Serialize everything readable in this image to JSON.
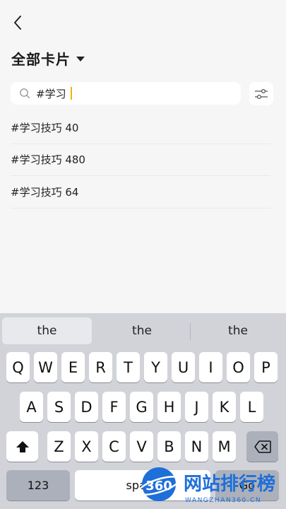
{
  "header": {
    "title": "全部卡片"
  },
  "search": {
    "query": "#学习"
  },
  "results": [
    "#学习技巧 40",
    "#学习技巧 480",
    "#学习技巧 64"
  ],
  "keyboard": {
    "suggestions": [
      "the",
      "the",
      "the"
    ],
    "row1": [
      "Q",
      "W",
      "E",
      "R",
      "T",
      "Y",
      "U",
      "I",
      "O",
      "P"
    ],
    "row2": [
      "A",
      "S",
      "D",
      "F",
      "G",
      "H",
      "J",
      "K",
      "L"
    ],
    "row3": [
      "Z",
      "X",
      "C",
      "V",
      "B",
      "N",
      "M"
    ],
    "numbers_label": "123",
    "space_label": "space",
    "go_label": "Go"
  },
  "watermark": {
    "badge": "360",
    "text": "网站排行榜",
    "url": "WANGZHAN360.CN"
  },
  "colors": {
    "cursor": "#f0b400",
    "keyboard_bg": "#d1d3d9",
    "watermark_blue": "#1e6fd9"
  }
}
